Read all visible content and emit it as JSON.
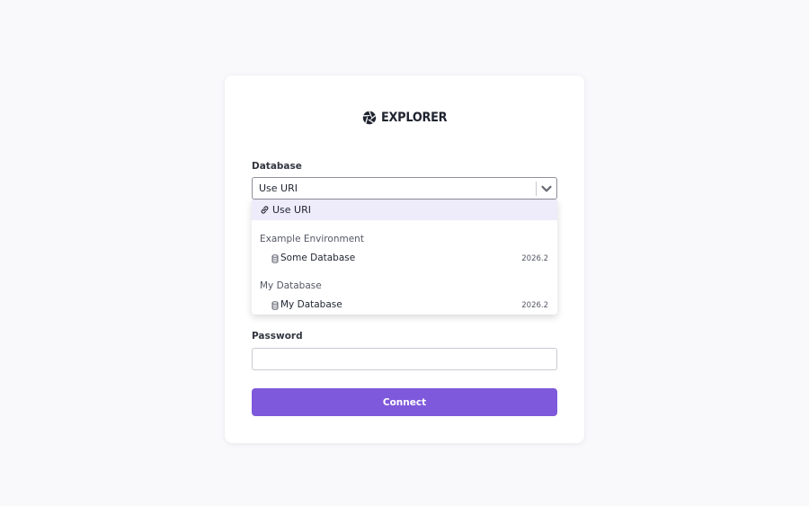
{
  "app": {
    "logo_text": "EXPLORER"
  },
  "form": {
    "database_label": "Database",
    "database_selected": "Use URI",
    "password_label": "Password",
    "password_value": "",
    "connect_label": "Connect"
  },
  "dropdown": {
    "uri_option": {
      "label": "Use URI",
      "icon": "link-icon"
    },
    "groups": [
      {
        "header": "Example Environment",
        "items": [
          {
            "label": "Some Database",
            "version": "2026.2",
            "icon": "database-icon"
          }
        ]
      },
      {
        "header": "My Database",
        "items": [
          {
            "label": "My Database",
            "version": "2026.2",
            "icon": "database-icon"
          }
        ]
      }
    ]
  },
  "colors": {
    "accent": "#7e59db",
    "highlight": "#eeebfb",
    "background": "#f9f9fc"
  }
}
